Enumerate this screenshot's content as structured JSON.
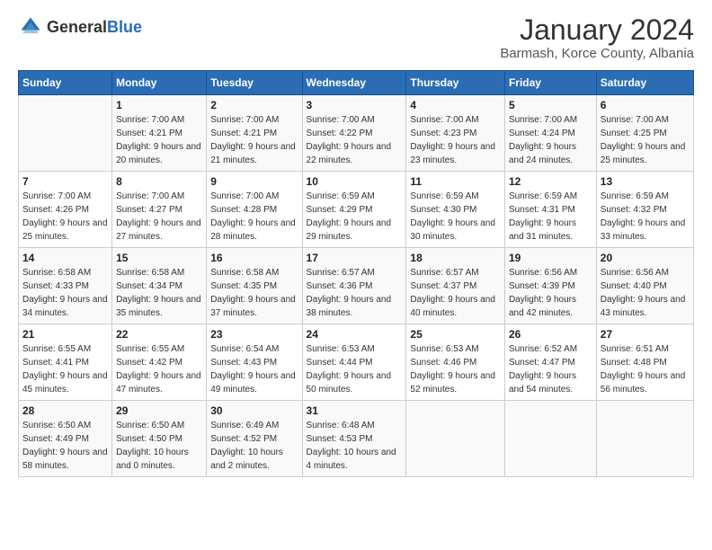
{
  "header": {
    "logo_general": "General",
    "logo_blue": "Blue",
    "main_title": "January 2024",
    "subtitle": "Barmash, Korce County, Albania"
  },
  "columns": [
    "Sunday",
    "Monday",
    "Tuesday",
    "Wednesday",
    "Thursday",
    "Friday",
    "Saturday"
  ],
  "weeks": [
    [
      {
        "day": "",
        "sunrise": "",
        "sunset": "",
        "daylight": ""
      },
      {
        "day": "1",
        "sunrise": "Sunrise: 7:00 AM",
        "sunset": "Sunset: 4:21 PM",
        "daylight": "Daylight: 9 hours and 20 minutes."
      },
      {
        "day": "2",
        "sunrise": "Sunrise: 7:00 AM",
        "sunset": "Sunset: 4:21 PM",
        "daylight": "Daylight: 9 hours and 21 minutes."
      },
      {
        "day": "3",
        "sunrise": "Sunrise: 7:00 AM",
        "sunset": "Sunset: 4:22 PM",
        "daylight": "Daylight: 9 hours and 22 minutes."
      },
      {
        "day": "4",
        "sunrise": "Sunrise: 7:00 AM",
        "sunset": "Sunset: 4:23 PM",
        "daylight": "Daylight: 9 hours and 23 minutes."
      },
      {
        "day": "5",
        "sunrise": "Sunrise: 7:00 AM",
        "sunset": "Sunset: 4:24 PM",
        "daylight": "Daylight: 9 hours and 24 minutes."
      },
      {
        "day": "6",
        "sunrise": "Sunrise: 7:00 AM",
        "sunset": "Sunset: 4:25 PM",
        "daylight": "Daylight: 9 hours and 25 minutes."
      }
    ],
    [
      {
        "day": "7",
        "sunrise": "Sunrise: 7:00 AM",
        "sunset": "Sunset: 4:26 PM",
        "daylight": "Daylight: 9 hours and 25 minutes."
      },
      {
        "day": "8",
        "sunrise": "Sunrise: 7:00 AM",
        "sunset": "Sunset: 4:27 PM",
        "daylight": "Daylight: 9 hours and 27 minutes."
      },
      {
        "day": "9",
        "sunrise": "Sunrise: 7:00 AM",
        "sunset": "Sunset: 4:28 PM",
        "daylight": "Daylight: 9 hours and 28 minutes."
      },
      {
        "day": "10",
        "sunrise": "Sunrise: 6:59 AM",
        "sunset": "Sunset: 4:29 PM",
        "daylight": "Daylight: 9 hours and 29 minutes."
      },
      {
        "day": "11",
        "sunrise": "Sunrise: 6:59 AM",
        "sunset": "Sunset: 4:30 PM",
        "daylight": "Daylight: 9 hours and 30 minutes."
      },
      {
        "day": "12",
        "sunrise": "Sunrise: 6:59 AM",
        "sunset": "Sunset: 4:31 PM",
        "daylight": "Daylight: 9 hours and 31 minutes."
      },
      {
        "day": "13",
        "sunrise": "Sunrise: 6:59 AM",
        "sunset": "Sunset: 4:32 PM",
        "daylight": "Daylight: 9 hours and 33 minutes."
      }
    ],
    [
      {
        "day": "14",
        "sunrise": "Sunrise: 6:58 AM",
        "sunset": "Sunset: 4:33 PM",
        "daylight": "Daylight: 9 hours and 34 minutes."
      },
      {
        "day": "15",
        "sunrise": "Sunrise: 6:58 AM",
        "sunset": "Sunset: 4:34 PM",
        "daylight": "Daylight: 9 hours and 35 minutes."
      },
      {
        "day": "16",
        "sunrise": "Sunrise: 6:58 AM",
        "sunset": "Sunset: 4:35 PM",
        "daylight": "Daylight: 9 hours and 37 minutes."
      },
      {
        "day": "17",
        "sunrise": "Sunrise: 6:57 AM",
        "sunset": "Sunset: 4:36 PM",
        "daylight": "Daylight: 9 hours and 38 minutes."
      },
      {
        "day": "18",
        "sunrise": "Sunrise: 6:57 AM",
        "sunset": "Sunset: 4:37 PM",
        "daylight": "Daylight: 9 hours and 40 minutes."
      },
      {
        "day": "19",
        "sunrise": "Sunrise: 6:56 AM",
        "sunset": "Sunset: 4:39 PM",
        "daylight": "Daylight: 9 hours and 42 minutes."
      },
      {
        "day": "20",
        "sunrise": "Sunrise: 6:56 AM",
        "sunset": "Sunset: 4:40 PM",
        "daylight": "Daylight: 9 hours and 43 minutes."
      }
    ],
    [
      {
        "day": "21",
        "sunrise": "Sunrise: 6:55 AM",
        "sunset": "Sunset: 4:41 PM",
        "daylight": "Daylight: 9 hours and 45 minutes."
      },
      {
        "day": "22",
        "sunrise": "Sunrise: 6:55 AM",
        "sunset": "Sunset: 4:42 PM",
        "daylight": "Daylight: 9 hours and 47 minutes."
      },
      {
        "day": "23",
        "sunrise": "Sunrise: 6:54 AM",
        "sunset": "Sunset: 4:43 PM",
        "daylight": "Daylight: 9 hours and 49 minutes."
      },
      {
        "day": "24",
        "sunrise": "Sunrise: 6:53 AM",
        "sunset": "Sunset: 4:44 PM",
        "daylight": "Daylight: 9 hours and 50 minutes."
      },
      {
        "day": "25",
        "sunrise": "Sunrise: 6:53 AM",
        "sunset": "Sunset: 4:46 PM",
        "daylight": "Daylight: 9 hours and 52 minutes."
      },
      {
        "day": "26",
        "sunrise": "Sunrise: 6:52 AM",
        "sunset": "Sunset: 4:47 PM",
        "daylight": "Daylight: 9 hours and 54 minutes."
      },
      {
        "day": "27",
        "sunrise": "Sunrise: 6:51 AM",
        "sunset": "Sunset: 4:48 PM",
        "daylight": "Daylight: 9 hours and 56 minutes."
      }
    ],
    [
      {
        "day": "28",
        "sunrise": "Sunrise: 6:50 AM",
        "sunset": "Sunset: 4:49 PM",
        "daylight": "Daylight: 9 hours and 58 minutes."
      },
      {
        "day": "29",
        "sunrise": "Sunrise: 6:50 AM",
        "sunset": "Sunset: 4:50 PM",
        "daylight": "Daylight: 10 hours and 0 minutes."
      },
      {
        "day": "30",
        "sunrise": "Sunrise: 6:49 AM",
        "sunset": "Sunset: 4:52 PM",
        "daylight": "Daylight: 10 hours and 2 minutes."
      },
      {
        "day": "31",
        "sunrise": "Sunrise: 6:48 AM",
        "sunset": "Sunset: 4:53 PM",
        "daylight": "Daylight: 10 hours and 4 minutes."
      },
      {
        "day": "",
        "sunrise": "",
        "sunset": "",
        "daylight": ""
      },
      {
        "day": "",
        "sunrise": "",
        "sunset": "",
        "daylight": ""
      },
      {
        "day": "",
        "sunrise": "",
        "sunset": "",
        "daylight": ""
      }
    ]
  ]
}
